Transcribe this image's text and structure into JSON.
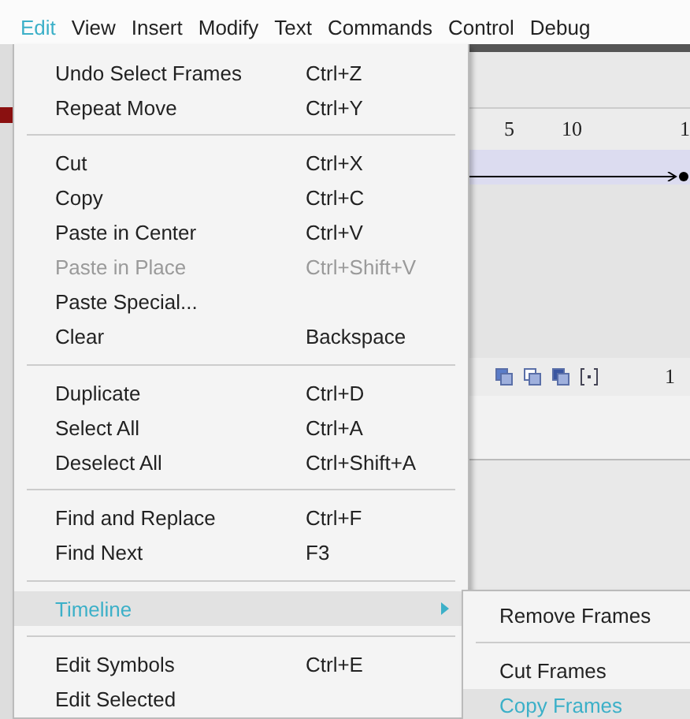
{
  "menu_bar": [
    {
      "label": "Edit",
      "selected": true
    },
    {
      "label": "View",
      "selected": false
    },
    {
      "label": "Insert",
      "selected": false
    },
    {
      "label": "Modify",
      "selected": false
    },
    {
      "label": "Text",
      "selected": false
    },
    {
      "label": "Commands",
      "selected": false
    },
    {
      "label": "Control",
      "selected": false
    },
    {
      "label": "Debug",
      "selected": false
    }
  ],
  "edit_menu": [
    {
      "kind": "item",
      "label": "Undo Select Frames",
      "shortcut": "Ctrl+Z",
      "disabled": false,
      "selected": false,
      "submenu": false
    },
    {
      "kind": "item",
      "label": "Repeat Move",
      "shortcut": "Ctrl+Y",
      "disabled": false,
      "selected": false,
      "submenu": false
    },
    {
      "kind": "separator"
    },
    {
      "kind": "item",
      "label": "Cut",
      "shortcut": "Ctrl+X",
      "disabled": false,
      "selected": false,
      "submenu": false
    },
    {
      "kind": "item",
      "label": "Copy",
      "shortcut": "Ctrl+C",
      "disabled": false,
      "selected": false,
      "submenu": false
    },
    {
      "kind": "item",
      "label": "Paste in Center",
      "shortcut": "Ctrl+V",
      "disabled": false,
      "selected": false,
      "submenu": false
    },
    {
      "kind": "item",
      "label": "Paste in Place",
      "shortcut": "Ctrl+Shift+V",
      "disabled": true,
      "selected": false,
      "submenu": false
    },
    {
      "kind": "item",
      "label": "Paste Special...",
      "disabled": false,
      "selected": false,
      "submenu": false
    },
    {
      "kind": "item",
      "label": "Clear",
      "shortcut": "Backspace",
      "disabled": false,
      "selected": false,
      "submenu": false
    },
    {
      "kind": "separator"
    },
    {
      "kind": "item",
      "label": "Duplicate",
      "shortcut": "Ctrl+D",
      "disabled": false,
      "selected": false,
      "submenu": false
    },
    {
      "kind": "item",
      "label": "Select All",
      "shortcut": "Ctrl+A",
      "disabled": false,
      "selected": false,
      "submenu": false
    },
    {
      "kind": "item",
      "label": "Deselect All",
      "shortcut": "Ctrl+Shift+A",
      "disabled": false,
      "selected": false,
      "submenu": false
    },
    {
      "kind": "separator"
    },
    {
      "kind": "item",
      "label": "Find and Replace",
      "shortcut": "Ctrl+F",
      "disabled": false,
      "selected": false,
      "submenu": false
    },
    {
      "kind": "item",
      "label": "Find Next",
      "shortcut": "F3",
      "disabled": false,
      "selected": false,
      "submenu": false
    },
    {
      "kind": "separator"
    },
    {
      "kind": "item",
      "label": "Timeline",
      "disabled": false,
      "selected": true,
      "submenu": true
    },
    {
      "kind": "separator"
    },
    {
      "kind": "item",
      "label": "Edit Symbols",
      "shortcut": "Ctrl+E",
      "disabled": false,
      "selected": false,
      "submenu": false
    },
    {
      "kind": "item",
      "label": "Edit Selected",
      "disabled": false,
      "selected": false,
      "submenu": false
    }
  ],
  "timeline_submenu": [
    {
      "kind": "item",
      "label": "Remove Frames",
      "selected": false
    },
    {
      "kind": "separator"
    },
    {
      "kind": "item",
      "label": "Cut Frames",
      "selected": false
    },
    {
      "kind": "item",
      "label": "Copy Frames",
      "selected": true
    }
  ],
  "timeline": {
    "ruler": [
      "5",
      "10",
      "1"
    ],
    "frame_number": "1"
  }
}
